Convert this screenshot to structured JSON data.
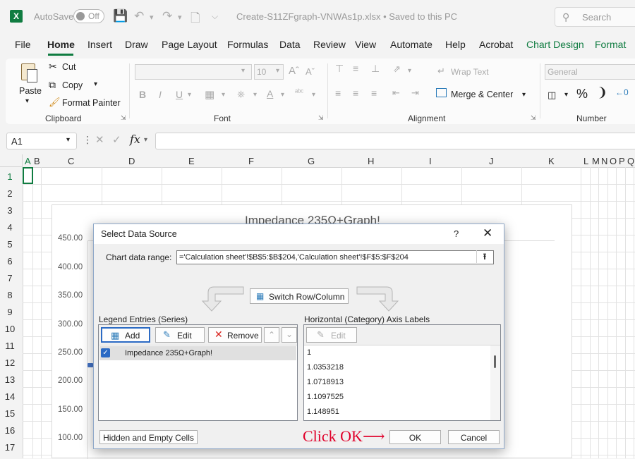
{
  "app": {
    "logo": "X",
    "autosave_label": "AutoSave",
    "autosave_state": "Off",
    "doc_title": "Create-S11ZFgraph-VNWAs1p.xlsx  •  Saved to this PC",
    "search_placeholder": "Search"
  },
  "tabs": [
    "File",
    "Home",
    "Insert",
    "Draw",
    "Page Layout",
    "Formulas",
    "Data",
    "Review",
    "View",
    "Automate",
    "Help",
    "Acrobat",
    "Chart Design",
    "Format"
  ],
  "ribbon": {
    "paste": "Paste",
    "cut": "Cut",
    "copy": "Copy",
    "format_painter": "Format Painter",
    "clipboard_label": "Clipboard",
    "font_size": "10",
    "font_label": "Font",
    "wrap_text": "Wrap Text",
    "merge_center": "Merge & Center",
    "alignment_label": "Alignment",
    "number_format": "General",
    "number_label": "Number"
  },
  "formula_bar": {
    "name_box": "A1",
    "fx": "fx",
    "value": ""
  },
  "columns": [
    "A",
    "B",
    "C",
    "D",
    "E",
    "F",
    "G",
    "H",
    "I",
    "J",
    "K",
    "L",
    "M",
    "N",
    "O",
    "P",
    "Q"
  ],
  "rows": [
    "1",
    "2",
    "3",
    "4",
    "5",
    "6",
    "7",
    "8",
    "9",
    "10",
    "11",
    "12",
    "13",
    "14",
    "15",
    "16",
    "17"
  ],
  "chart": {
    "title": "Impedance 235Ω+Graph!",
    "y_ticks": [
      "450.00",
      "400.00",
      "350.00",
      "300.00",
      "250.00",
      "200.00",
      "150.00",
      "100.00"
    ]
  },
  "dialog": {
    "title": "Select Data Source",
    "help": "?",
    "close": "✕",
    "range_label": "Chart data range:",
    "range_value": "='Calculation sheet'!$B$5:$B$204,'Calculation sheet'!$F$5:$F$204",
    "switch_label": "Switch Row/Column",
    "legend_header": "Legend Entries (Series)",
    "add_label": "Add",
    "edit_label": "Edit",
    "remove_label": "Remove",
    "series": [
      {
        "name": "Impedance 235Ω+Graph!",
        "checked": true
      }
    ],
    "axis_header": "Horizontal (Category) Axis Labels",
    "axis_edit_label": "Edit",
    "axis_labels": [
      "1",
      "1.0353218",
      "1.0718913",
      "1.1097525",
      "1.148951"
    ],
    "hidden_cells": "Hidden and Empty Cells",
    "annotation": "Click OK⟶",
    "ok": "OK",
    "cancel": "Cancel"
  },
  "colors": {
    "excel_green": "#107c41",
    "annotation_red": "#e0002a"
  }
}
